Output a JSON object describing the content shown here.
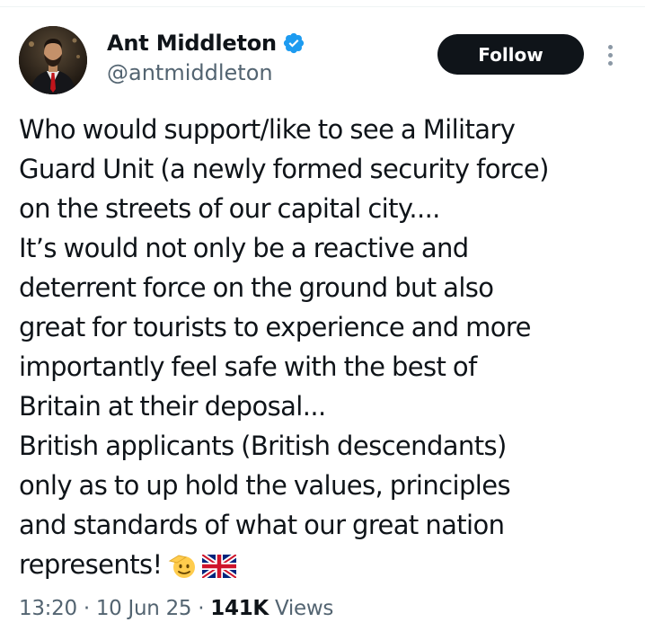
{
  "author": {
    "display_name": "Ant Middleton",
    "handle": "@antmiddleton",
    "verified": true,
    "verified_color": "#1d9bf0"
  },
  "follow_button": {
    "label": "Follow",
    "background": "#0f1419"
  },
  "more_button": {
    "icon": "more-vertical-icon"
  },
  "tweet": {
    "lines": [
      "Who would support/like to see a Military",
      "Guard Unit (a newly formed security force)",
      "on the streets of our capital city....",
      "It’s would not only be a reactive and",
      "deterrent force on the ground but also",
      "great for tourists to experience and more",
      "importantly feel safe with the best of",
      "Britain at their deposal...",
      "British applicants (British descendants)",
      "only as to up hold the values, principles",
      "and standards of what our great nation",
      "represents!"
    ],
    "emojis": [
      "saluting-face-emoji",
      "uk-flag-emoji"
    ]
  },
  "meta": {
    "time": "13:20",
    "separator": "·",
    "date": "10 Jun 25",
    "views_count": "141K",
    "views_label": "Views"
  }
}
